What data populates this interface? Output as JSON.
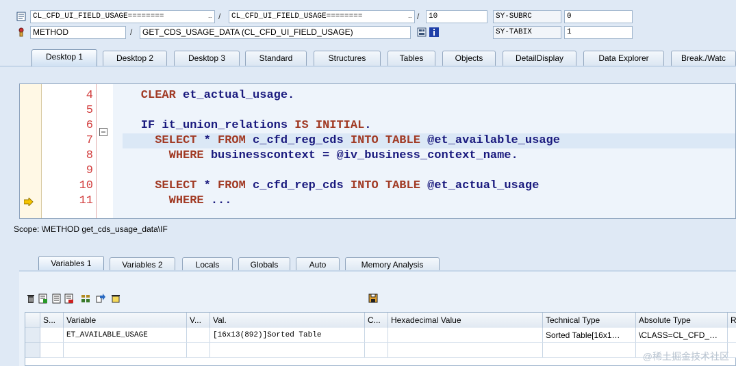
{
  "header": {
    "row1": {
      "program1": "CL_CFD_UI_FIELD_USAGE========",
      "program2": "CL_CFD_UI_FIELD_USAGE========",
      "line": "10",
      "sy_label1": "SY-SUBRC",
      "sy_value1": "0"
    },
    "row2": {
      "type": "METHOD",
      "method": "GET_CDS_USAGE_DATA (CL_CFD_UI_FIELD_USAGE)",
      "sy_label2": "SY-TABIX",
      "sy_value2": "1"
    },
    "slash": "/"
  },
  "top_tabs": [
    "Desktop 1",
    "Desktop 2",
    "Desktop 3",
    "Standard",
    "Structures",
    "Tables",
    "Objects",
    "DetailDisplay",
    "Data Explorer",
    "Break./Watc"
  ],
  "code": {
    "lines": [
      {
        "num": "4",
        "parts": [
          {
            "t": "    CLEAR",
            "k": true
          },
          {
            "t": " et_actual_usage.",
            "k": false
          }
        ]
      },
      {
        "num": "5",
        "parts": []
      },
      {
        "num": "6",
        "parts": [
          {
            "t": "    IF",
            "k": false
          },
          {
            "t": " it_union_relations ",
            "k": false
          },
          {
            "t": "IS INITIAL",
            "k": true
          },
          {
            "t": ".",
            "k": false
          }
        ]
      },
      {
        "num": "7",
        "parts": [
          {
            "t": "      SELECT",
            "k": true
          },
          {
            "t": " * ",
            "k": false
          },
          {
            "t": "FROM",
            "k": true
          },
          {
            "t": " c_cfd_reg_cds ",
            "k": false
          },
          {
            "t": "INTO TABLE",
            "k": true
          },
          {
            "t": " @et_available_usage",
            "k": false
          }
        ]
      },
      {
        "num": "8",
        "parts": [
          {
            "t": "        WHERE",
            "k": true
          },
          {
            "t": " businesscontext = @iv_business_context_name.",
            "k": false
          }
        ]
      },
      {
        "num": "9",
        "parts": []
      },
      {
        "num": "10",
        "parts": [
          {
            "t": "      SELECT",
            "k": true
          },
          {
            "t": " * ",
            "k": false
          },
          {
            "t": "FROM",
            "k": true
          },
          {
            "t": " c_cfd_rep_cds ",
            "k": false
          },
          {
            "t": "INTO TABLE",
            "k": true
          },
          {
            "t": " @et_actual_usage",
            "k": false
          }
        ]
      },
      {
        "num": "11",
        "parts": [
          {
            "t": "        WHERE",
            "k": true
          },
          {
            "t": " ...",
            "k": false
          }
        ]
      }
    ]
  },
  "scope": "Scope: \\METHOD get_cds_usage_data\\IF",
  "var_tabs": [
    "Variables 1",
    "Variables 2",
    "Locals",
    "Globals",
    "Auto",
    "Memory Analysis"
  ],
  "table": {
    "headers": [
      "S...",
      "Variable",
      "V...",
      "Val.",
      "C...",
      "Hexadecimal Value",
      "Technical Type",
      "Absolute Type",
      "R"
    ],
    "rows": [
      [
        "",
        "ET_AVAILABLE_USAGE",
        "",
        "[16x13(892)]Sorted Table",
        "",
        "",
        "Sorted Table[16x1…",
        "\\CLASS=CL_CFD_…",
        ""
      ],
      [
        "",
        "",
        "",
        "",
        "",
        "",
        "",
        "",
        ""
      ]
    ]
  },
  "watermark": "@稀土掘金技术社区",
  "icons": {
    "row1": "program-icon",
    "row2": "method-icon",
    "toolbar": [
      "delete-icon",
      "insert-icon",
      "copy-icon",
      "save-list-icon",
      "layout-icon",
      "transfer-icon",
      "folder-icon",
      "save-icon"
    ]
  }
}
